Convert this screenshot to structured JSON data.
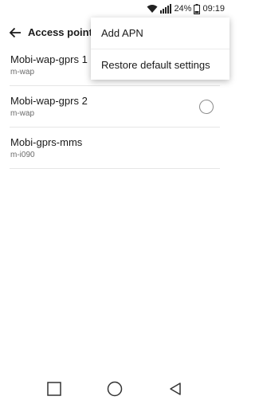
{
  "status_bar": {
    "battery_percent": "24%",
    "time": "09:19",
    "icons": [
      "wifi-icon",
      "signal-icon",
      "battery-icon"
    ]
  },
  "app_bar": {
    "title": "Access point names",
    "back_icon": "arrow-left-icon"
  },
  "apn_list": {
    "items": [
      {
        "name": "Mobi-wap-gprs 1",
        "apn": "m-wap",
        "has_radio": false
      },
      {
        "name": "Mobi-wap-gprs 2",
        "apn": "m-wap",
        "has_radio": true,
        "selected": false
      },
      {
        "name": "Mobi-gprs-mms",
        "apn": "m-i090",
        "has_radio": false
      }
    ]
  },
  "menu": {
    "items": [
      {
        "label": "Add APN"
      },
      {
        "label": "Restore default settings"
      }
    ]
  },
  "nav_bar": {
    "buttons": [
      "recents-square-icon",
      "home-circle-icon",
      "back-triangle-icon"
    ]
  }
}
